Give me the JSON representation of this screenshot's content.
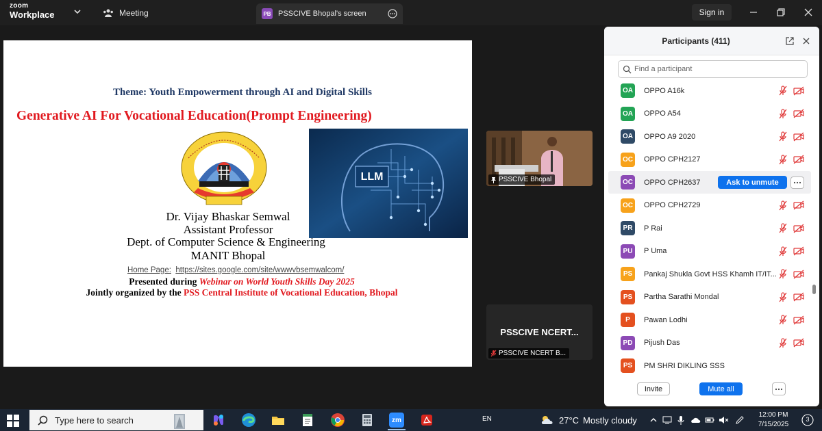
{
  "app": {
    "brand_small": "zoom",
    "brand_big": "Workplace",
    "meeting_tab": "Meeting",
    "share_badge": "PB",
    "share_tab": "PSSCIVE Bhopal's screen",
    "signin": "Sign in"
  },
  "slide": {
    "theme": "Theme: Youth Empowerment through AI and Digital Skills",
    "title": "Generative AI For Vocational Education(Prompt Engineering)",
    "image_label": "LLM",
    "name": "Dr. Vijay Bhaskar Semwal",
    "role": "Assistant Professor",
    "dept": "Dept. of Computer Science & Engineering",
    "inst": "MANIT Bhopal",
    "homepage_label": "Home Page:",
    "homepage_url": "https://sites.google.com/site/wwwvbsemwalcom/",
    "presented_prefix": "Presented during ",
    "presented_event": "Webinar on World Youth Skills Day 2025",
    "jointly_prefix": "Jointly organized by the ",
    "jointly_org": "PSS Central Institute of Vocational Education, Bhopal"
  },
  "video": {
    "tile1_label": "PSSCIVE Bhopal",
    "tile2_name": "PSSCIVE  NCERT...",
    "tile2_label": "PSSCIVE NCERT B..."
  },
  "participants": {
    "title": "Participants (411)",
    "search_placeholder": "Find a participant",
    "ask_to_unmute": "Ask to unmute",
    "list": [
      {
        "initials": "OA",
        "name": "OPPO A16k",
        "color": "#23a455"
      },
      {
        "initials": "OA",
        "name": "OPPO A54",
        "color": "#23a455"
      },
      {
        "initials": "OA",
        "name": "OPPO A9 2020",
        "color": "#2f4a66"
      },
      {
        "initials": "OC",
        "name": "OPPO CPH2127",
        "color": "#f7a21b"
      },
      {
        "initials": "OC",
        "name": "OPPO CPH2637",
        "color": "#8c4ab5"
      },
      {
        "initials": "OC",
        "name": "OPPO CPH2729",
        "color": "#f7a21b"
      },
      {
        "initials": "PR",
        "name": "P Rai",
        "color": "#2f4a66"
      },
      {
        "initials": "PU",
        "name": "P Uma",
        "color": "#8c4ab5"
      },
      {
        "initials": "PS",
        "name": "Pankaj Shukla Govt HSS Khamh IT/IT...",
        "color": "#f7a21b"
      },
      {
        "initials": "PS",
        "name": "Partha Sarathi Mondal",
        "color": "#e4501f"
      },
      {
        "initials": "P",
        "name": "Pawan Lodhi",
        "color": "#e4501f"
      },
      {
        "initials": "PD",
        "name": "Pijush Das",
        "color": "#8c4ab5"
      },
      {
        "initials": "PS",
        "name": "PM SHRI DIKLING SSS",
        "color": "#e4501f"
      }
    ],
    "invite": "Invite",
    "mute_all": "Mute all"
  },
  "taskbar": {
    "search_placeholder": "Type here to search",
    "zoom_icon_text": "zm",
    "lang": "EN",
    "weather_temp": "27°C",
    "weather_desc": "Mostly cloudy",
    "time": "12:00 PM",
    "date": "7/15/2025",
    "notif_count": "3"
  }
}
